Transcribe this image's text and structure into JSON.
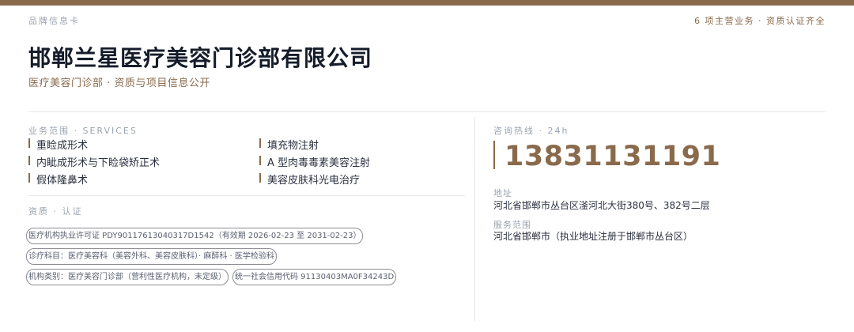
{
  "header": {
    "brand_tag": "品牌信息卡",
    "tagline": "6 项主营业务 · 资质认证齐全"
  },
  "company": {
    "name": "邯郸兰星医疗美容门诊部有限公司",
    "subtitle": "医疗美容门诊部 · 资质与项目信息公开"
  },
  "services": {
    "label": "业务范围 · SERVICES",
    "items": [
      "重睑成形术",
      "填充物注射",
      "内眦成形术与下睑袋矫正术",
      "A 型肉毒毒素美容注射",
      "假体隆鼻术",
      "美容皮肤科光电治疗"
    ]
  },
  "qualifications": {
    "label": "资质 · 认证",
    "pills": [
      "医疗机构执业许可证 PDY90117613040317D1542（有效期 2026-02-23 至 2031-02-23）",
      "诊疗科目：医疗美容科（美容外科、美容皮肤科）· 麻醉科 · 医学检验科",
      "机构类别：医疗美容门诊部（营利性医疗机构，未定级）",
      "统一社会信用代码 91130403MA0F34243D"
    ]
  },
  "contact": {
    "hotline_label": "咨询热线 · 24h",
    "phone": "13831131191",
    "address_label": "地址",
    "address": "河北省邯郸市丛台区滏河北大街380号、382号二层",
    "scope_label": "服务范围",
    "scope": "河北省邯郸市（执业地址注册于邯郸市丛台区）"
  },
  "colors": {
    "accent": "#8a6a4c",
    "heading": "#151c2a",
    "muted": "#9aa3b0"
  }
}
